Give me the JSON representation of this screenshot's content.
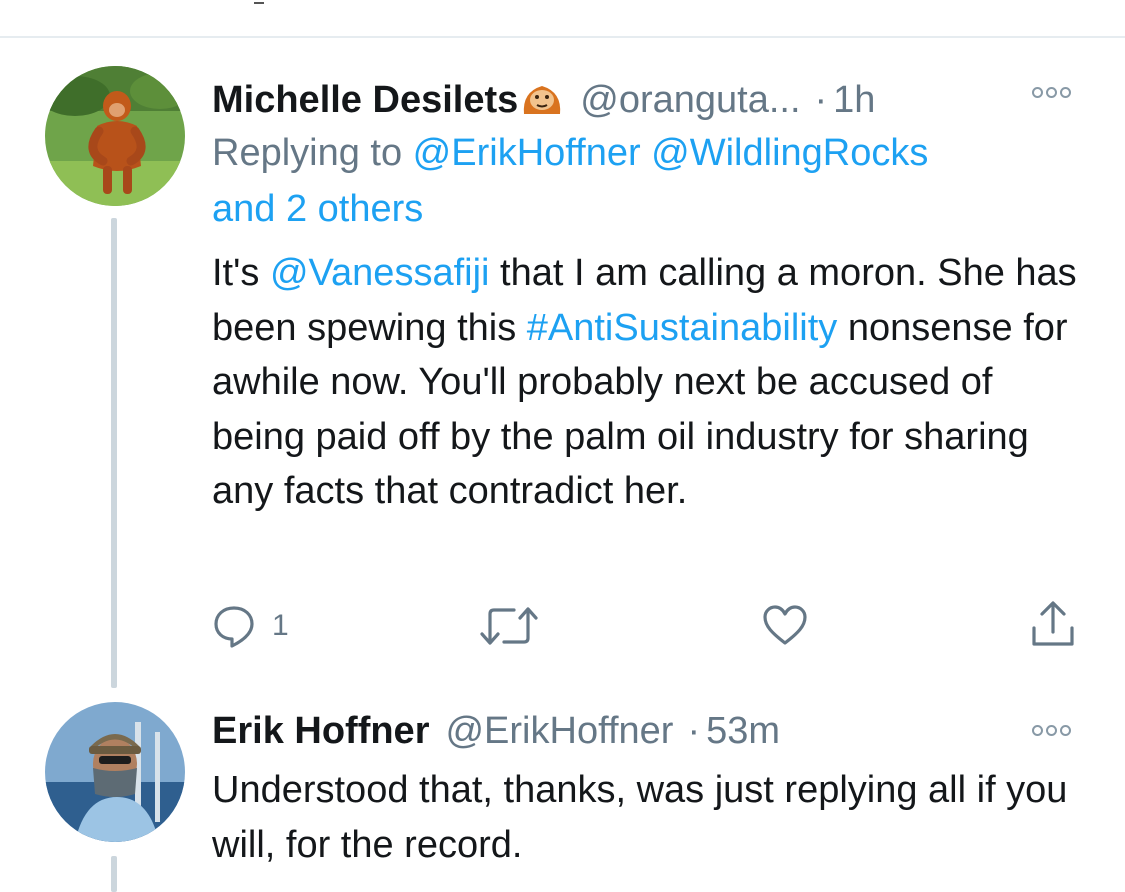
{
  "tweets": [
    {
      "name": "Michelle Desilets",
      "handle": "@oranguta...",
      "dot": "·",
      "time": "1h",
      "replying_prefix": "Replying to ",
      "replying_mentions": "@ErikHoffner @WildlingRocks",
      "replying_others": "and 2 others",
      "text": {
        "p1": "It's ",
        "mention": "@Vanessafiji",
        "p2": " that I am calling a moron. She has been spewing this ",
        "hashtag": "#AntiSustainability",
        "p3": " nonsense for awhile now. You'll probably next be accused of being paid off by the palm oil industry for sharing any facts that contradict her."
      },
      "actions": {
        "reply_count": "1"
      }
    },
    {
      "name": "Erik Hoffner",
      "handle": "@ErikHoffner",
      "dot": "·",
      "time": "53m",
      "text": "Understood that, thanks, was just replying all if you will, for the record."
    }
  ],
  "icons": {
    "reply": "reply-icon",
    "retweet": "retweet-icon",
    "like": "heart-icon",
    "share": "share-icon",
    "more": "more-icon",
    "badge": "orangutan-emoji-icon"
  },
  "colors": {
    "link": "#1da1f2",
    "secondary_text": "#657786",
    "thread_line": "#ccd6dd"
  }
}
